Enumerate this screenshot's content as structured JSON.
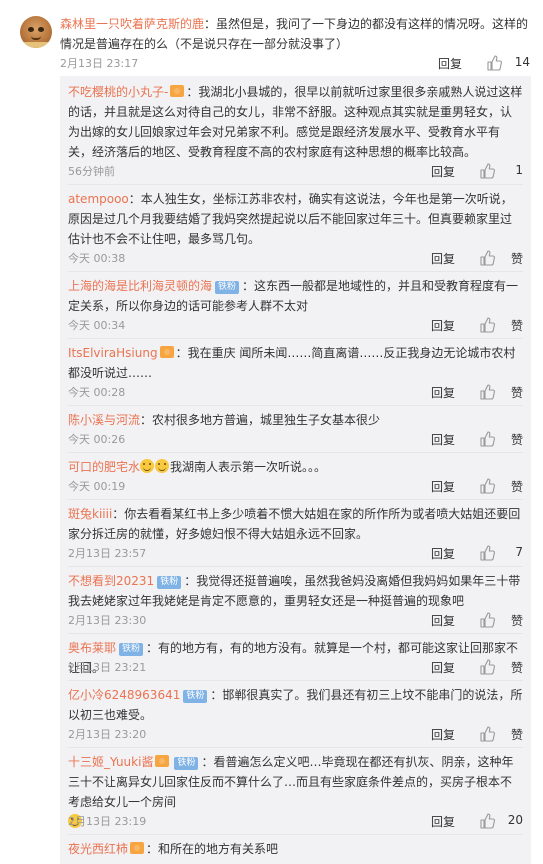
{
  "main_comment": {
    "username": "森林里一只吹着萨克斯的鹿",
    "text": "：虽然但是，我问了一下身边的都没有这样的情况呀。这样的情况是普遍存在的么（不是说只存在一部分就没事了）",
    "time": "2月13日 23:17",
    "reply_label": "回复",
    "likes": "14"
  },
  "replies": [
    {
      "username": "不吃樱桃的小丸子-",
      "badge": "vip",
      "text": "：我湖北小县城的，很早以前就听过家里很多亲戚熟人说过这样的话，并且就是这么对待自己的女儿，非常不舒服。这种观点其实就是重男轻女，认为出嫁的女儿回娘家过年会对兄弟家不利。感觉是跟经济发展水平、受教育水平有关，经济落后的地区、受教育程度不高的农村家庭有这种思想的概率比较高。",
      "time": "56分钟前",
      "reply_label": "回复",
      "likes": "1"
    },
    {
      "username": "atempooo",
      "text": "：本人独生女，坐标江苏非农村，确实有这说法，今年也是第一次听说，原因是过几个月我要结婚了我妈突然提起说以后不能回家过年三十。但真要赖家里过估计也不会不让住吧，最多骂几句。",
      "time": "今天 00:38",
      "reply_label": "回复",
      "likes": "赞"
    },
    {
      "username": "上海的海是比利海灵顿的海",
      "badge": "fan",
      "badge_text": "铁粉",
      "text": "：这东西一般都是地域性的，并且和受教育程度有一定关系，所以你身边的话可能参考人群不太对",
      "time": "今天 00:34",
      "reply_label": "回复",
      "likes": "赞"
    },
    {
      "username": "ItsElviraHsiung",
      "badge": "vip",
      "text": "：我在重庆 闻所未闻……简直离谱……反正我身边无论城市农村都没听说过……",
      "time": "今天 00:28",
      "reply_label": "回复",
      "likes": "赞"
    },
    {
      "username": "陈小溪与河流",
      "text": "：农村很多地方普遍，城里独生子女基本很少",
      "time": "今天 00:26",
      "reply_label": "回复",
      "likes": "赞"
    },
    {
      "username": "可口的肥宅水",
      "emoji_count": 2,
      "text": "我湖南人表示第一次听说。。。",
      "time": "今天 00:19",
      "reply_label": "回复",
      "likes": "赞"
    },
    {
      "username": "斑兔kiiii",
      "text": "：你去看看某红书上多少喷着不惯大姑姐在家的所作所为或者喷大姑姐还要回家分拆迁房的就懂，好多媳妇恨不得大姑姐永远不回家。",
      "time": "2月13日 23:57",
      "reply_label": "回复",
      "likes": "7"
    },
    {
      "username": "不想看到20231",
      "badge": "fan",
      "badge_text": "铁粉",
      "text": "：我觉得还挺普遍唉，虽然我爸妈没离婚但我妈妈如果年三十带我去姥姥家过年我姥姥是肯定不愿意的，重男轻女还是一种挺普遍的现象吧",
      "time": "2月13日 23:30",
      "reply_label": "回复",
      "likes": "赞"
    },
    {
      "username": "奥布莱耶",
      "badge": "fan",
      "badge_text": "铁粉",
      "text": "：有的地方有，有的地方没有。就算是一个村，都可能这家让回那家不让回。",
      "time": "2月13日 23:21",
      "reply_label": "回复",
      "likes": "赞"
    },
    {
      "username": "亿小冷6248963641",
      "badge": "fan",
      "badge_text": "铁粉",
      "text": "：邯郸很真实了。我们县还有初三上坟不能串门的说法，所以初三也难受。",
      "time": "2月13日 23:20",
      "reply_label": "回复",
      "likes": "赞"
    },
    {
      "username": "十三姬_Yuuki酱",
      "badge": "vip",
      "badge2_text": "铁粉",
      "text": "：看普遍怎么定义吧…毕竟现在都还有扒灰、阴亲，这种年三十不让离异女儿回家住反而不算什么了…而且有些家庭条件差点的，买房子根本不考虑给女儿一个房间",
      "trailing_emoji": true,
      "time": "2月13日 23:19",
      "reply_label": "回复",
      "likes": "20"
    },
    {
      "username": "夜光西红柿",
      "badge": "vip",
      "text": "：和所在的地方有关系吧",
      "time": "",
      "reply_label": "",
      "likes": ""
    }
  ]
}
